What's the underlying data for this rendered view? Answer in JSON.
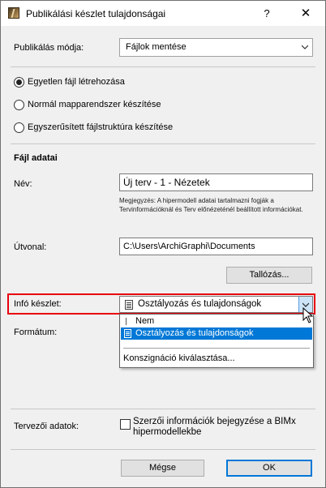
{
  "window": {
    "title": "Publikálási készlet tulajdonságai",
    "help_glyph": "?",
    "close_glyph": "✕"
  },
  "publish_mode": {
    "label": "Publikálás módja:",
    "value": "Fájlok mentése"
  },
  "structure_options": [
    {
      "label": "Egyetlen fájl létrehozása",
      "checked": true
    },
    {
      "label": "Normál mapparendszer készítése",
      "checked": false
    },
    {
      "label": "Egyszerűsített fájlstruktúra készítése",
      "checked": false
    }
  ],
  "file_data": {
    "heading": "Fájl adatai",
    "name_label": "Név:",
    "name_value": "Új terv - 1 - Nézetek",
    "note": "Megjegyzés: A hipermodell adatai tartalmazni fogják a Tervinformációknál és Terv előnézeténél beállított információkat.",
    "path_label": "Útvonal:",
    "path_value": "C:\\Users\\ArchiGraphi\\Documents",
    "browse_label": "Tallózás..."
  },
  "info_set": {
    "label": "Infó készlet:",
    "value": "Osztályozás és tulajdonságok",
    "dropdown_items": [
      {
        "label": "Nem",
        "selected": false
      },
      {
        "label": "Osztályozás és tulajdonságok",
        "selected": true
      },
      {
        "label": "Konszignáció kiválasztása...",
        "selected": false
      }
    ]
  },
  "format": {
    "label": "Formátum:"
  },
  "designer": {
    "label": "Tervezői adatok:",
    "checkbox_label_line1": "Szerzői információk bejegyzése a BIMx",
    "checkbox_label_line2": "hipermodellekbe",
    "checked": false
  },
  "footer": {
    "cancel_label": "Mégse",
    "ok_label": "OK"
  },
  "colors": {
    "highlight": "#e8000c",
    "selection": "#0078d7",
    "dialog_bg": "#f0f0f0"
  }
}
